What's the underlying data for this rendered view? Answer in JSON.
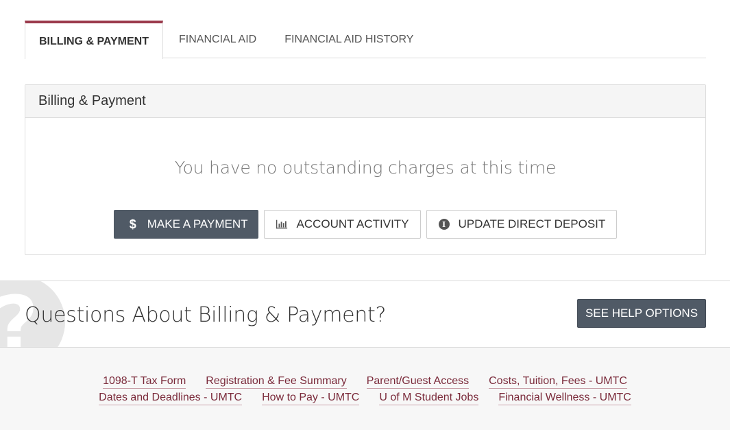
{
  "tabs": [
    {
      "label": "BILLING & PAYMENT",
      "active": true
    },
    {
      "label": "FINANCIAL AID",
      "active": false
    },
    {
      "label": "FINANCIAL AID HISTORY",
      "active": false
    }
  ],
  "panel": {
    "title": "Billing & Payment",
    "message": "You have no outstanding charges at this time",
    "buttons": {
      "make_payment": "MAKE A PAYMENT",
      "account_activity": "ACCOUNT ACTIVITY",
      "update_direct_deposit": "UPDATE DIRECT DEPOSIT"
    },
    "icons": {
      "make_payment": "dollar-icon",
      "account_activity": "bar-chart-icon",
      "update_direct_deposit": "info-circle-icon"
    }
  },
  "help": {
    "title": "Questions About Billing & Payment?",
    "button": "SEE HELP OPTIONS",
    "bg_icon": "question-mark-icon"
  },
  "footer": {
    "row1": [
      "1098-T Tax Form",
      "Registration & Fee Summary",
      "Parent/Guest Access",
      "Costs, Tuition, Fees - UMTC"
    ],
    "row2": [
      "Dates and Deadlines - UMTC",
      "How to Pay - UMTC",
      "U of M Student Jobs",
      "Financial Wellness - UMTC"
    ]
  },
  "colors": {
    "accent": "#9b3a4c",
    "button_dark": "#505a66",
    "link": "#7a2a3a"
  }
}
